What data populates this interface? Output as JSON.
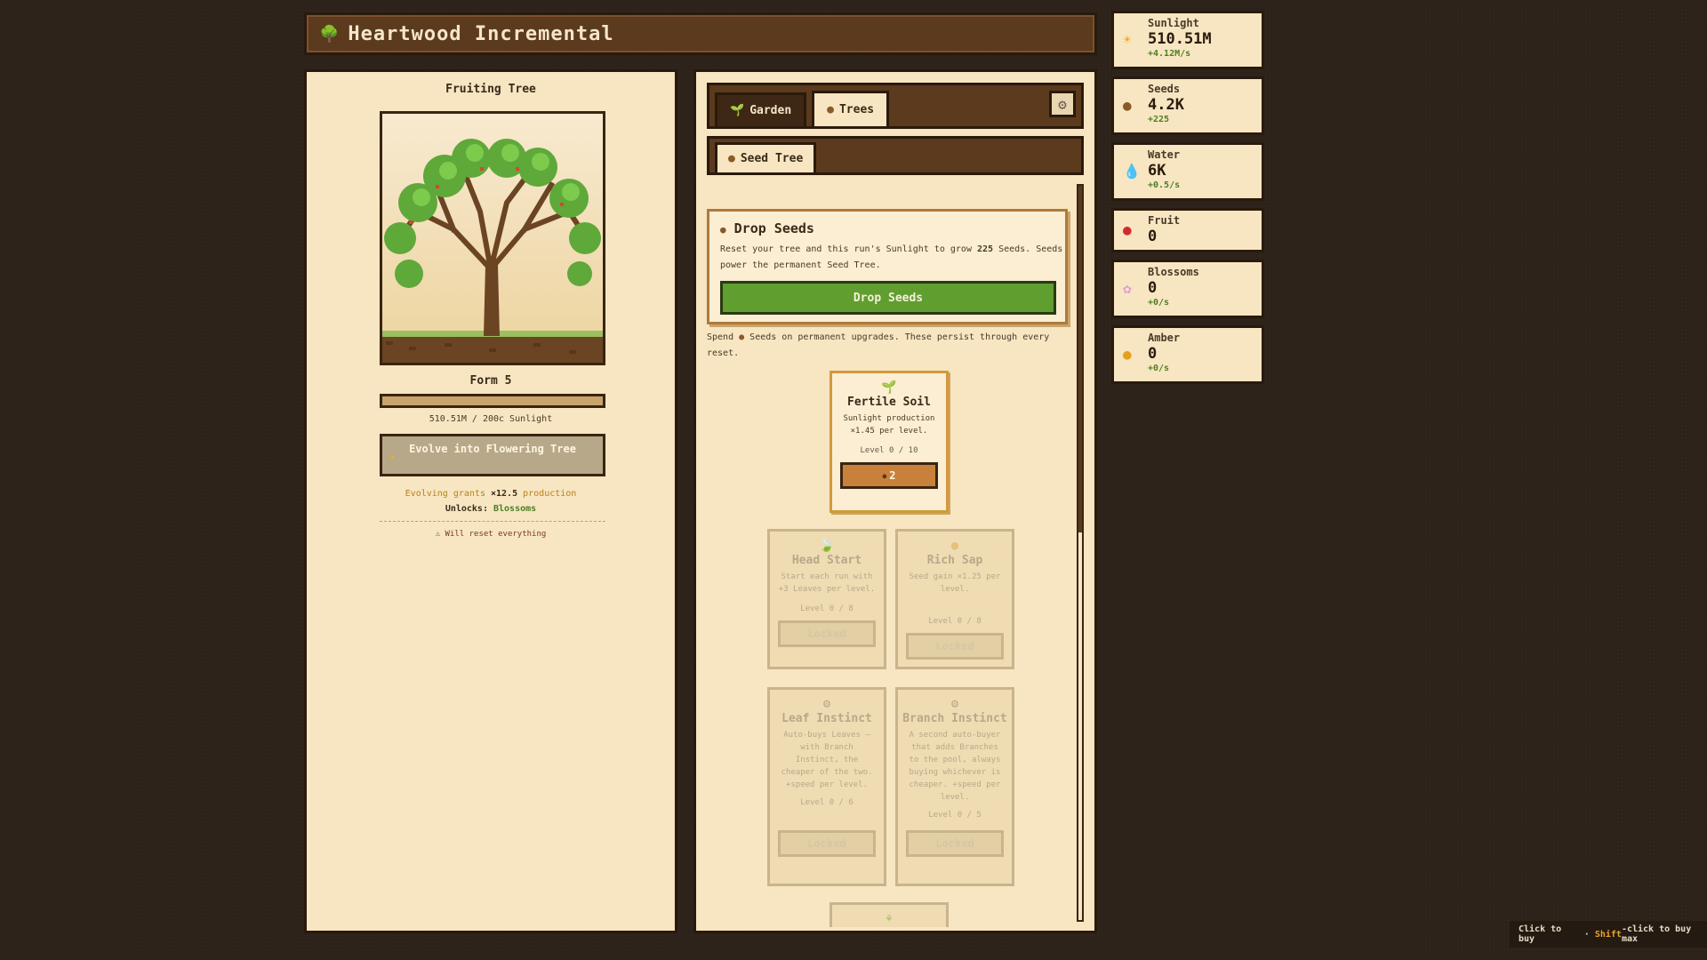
{
  "header": {
    "title": "Heartwood Incremental",
    "icon": "tree-icon"
  },
  "tree_panel": {
    "title": "Fruiting Tree",
    "form_label": "Form 5",
    "progress_fraction": 1.0,
    "progress_text": "510.51M / 200c Sunlight",
    "evolve_label": "Evolve into Flowering Tree",
    "grant_prefix": "Evolving grants ",
    "grant_value": "×12.5",
    "grant_suffix": " production",
    "unlock_prefix": "Unlocks: ",
    "unlock_value": "Blossoms",
    "warning": "⚠ Will reset everything"
  },
  "tabs": [
    {
      "label": "Garden",
      "icon": "sprout-icon",
      "active": false
    },
    {
      "label": "Trees",
      "icon": "acorn-icon",
      "active": true
    }
  ],
  "subtabs": [
    {
      "label": "Seed Tree",
      "icon": "acorn-icon"
    }
  ],
  "drop_seeds": {
    "title": "Drop Seeds",
    "text_before": "Reset your tree and this run's Sunlight to grow ",
    "seed_amount": "225",
    "text_after": " Seeds. Seeds power the permanent Seed Tree.",
    "button_label": "Drop Seeds"
  },
  "spend_text_before": "Spend ",
  "spend_text_after": " Seeds on permanent upgrades. These persist through every reset.",
  "upgrades": [
    {
      "name": "Fertile Soil",
      "desc": "Sunlight production ×1.45 per level.",
      "level": "Level 0 / 10",
      "button": "2",
      "icon": "sprout-icon",
      "state": "available"
    },
    {
      "name": "Head Start",
      "desc": "Start each run with +3 Leaves per level.",
      "level": "Level 0 / 8",
      "button": "Locked",
      "icon": "leaf-icon",
      "state": "locked"
    },
    {
      "name": "Rich Sap",
      "desc": "Seed gain ×1.25 per level.",
      "level": "Level 0 / 8",
      "button": "Locked",
      "icon": "sap-icon",
      "state": "locked"
    },
    {
      "name": "Leaf Instinct",
      "desc": "Auto-buys Leaves — with Branch Instinct, the cheaper of the two. +speed per level.",
      "level": "Level 0 / 6",
      "button": "Locked",
      "icon": "gear-icon",
      "state": "locked"
    },
    {
      "name": "Branch Instinct",
      "desc": "A second auto-buyer that adds Branches to the pool, always buying whichever is cheaper. +speed per level.",
      "level": "Level 0 / 5",
      "button": "Locked",
      "icon": "gear-icon",
      "state": "locked"
    }
  ],
  "resources": [
    {
      "name": "Sunlight",
      "value": "510.51M",
      "rate": "+4.12M/s",
      "icon": "sun-icon",
      "color": "#f2a51f"
    },
    {
      "name": "Seeds",
      "value": "4.2K",
      "rate": "+225",
      "icon": "acorn-icon",
      "color": "#8a5a2a"
    },
    {
      "name": "Water",
      "value": "6K",
      "rate": "+0.5/s",
      "icon": "droplet-icon",
      "color": "#3a7ad8"
    },
    {
      "name": "Fruit",
      "value": "0",
      "rate": "",
      "icon": "apple-icon",
      "color": "#d42a2a"
    },
    {
      "name": "Blossoms",
      "value": "0",
      "rate": "+0/s",
      "icon": "blossom-icon",
      "color": "#e49ad8"
    },
    {
      "name": "Amber",
      "value": "0",
      "rate": "+0/s",
      "icon": "amber-icon",
      "color": "#e8a01a"
    }
  ],
  "footer": {
    "click": "Click to buy",
    "sep": " · ",
    "shift": "Shift",
    "shift_rest": "-click to buy max"
  }
}
